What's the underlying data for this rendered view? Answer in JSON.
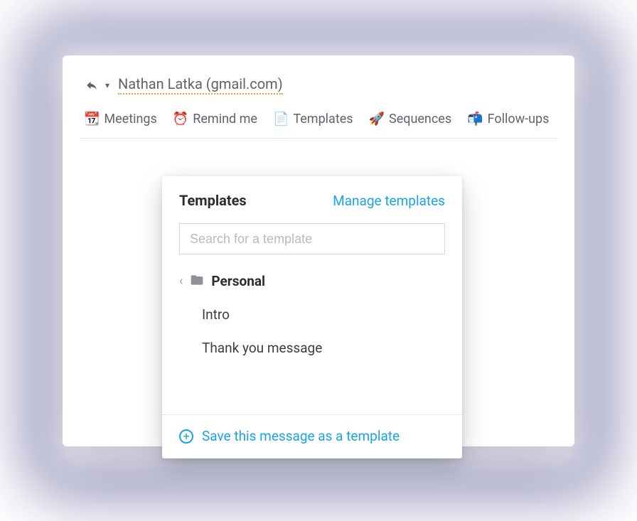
{
  "compose": {
    "recipient": "Nathan Latka (gmail.com)"
  },
  "toolbar": {
    "items": [
      {
        "icon": "📆",
        "label": "Meetings"
      },
      {
        "icon": "⏰",
        "label": "Remind me"
      },
      {
        "icon": "📄",
        "label": "Templates"
      },
      {
        "icon": "🚀",
        "label": "Sequences"
      },
      {
        "icon": "📬",
        "label": "Follow-ups"
      }
    ]
  },
  "templates_dropdown": {
    "title": "Templates",
    "manage_label": "Manage templates",
    "search_placeholder": "Search for a template",
    "folder_label": "Personal",
    "items": [
      "Intro",
      "Thank you message"
    ],
    "save_label": "Save this message as a template"
  }
}
